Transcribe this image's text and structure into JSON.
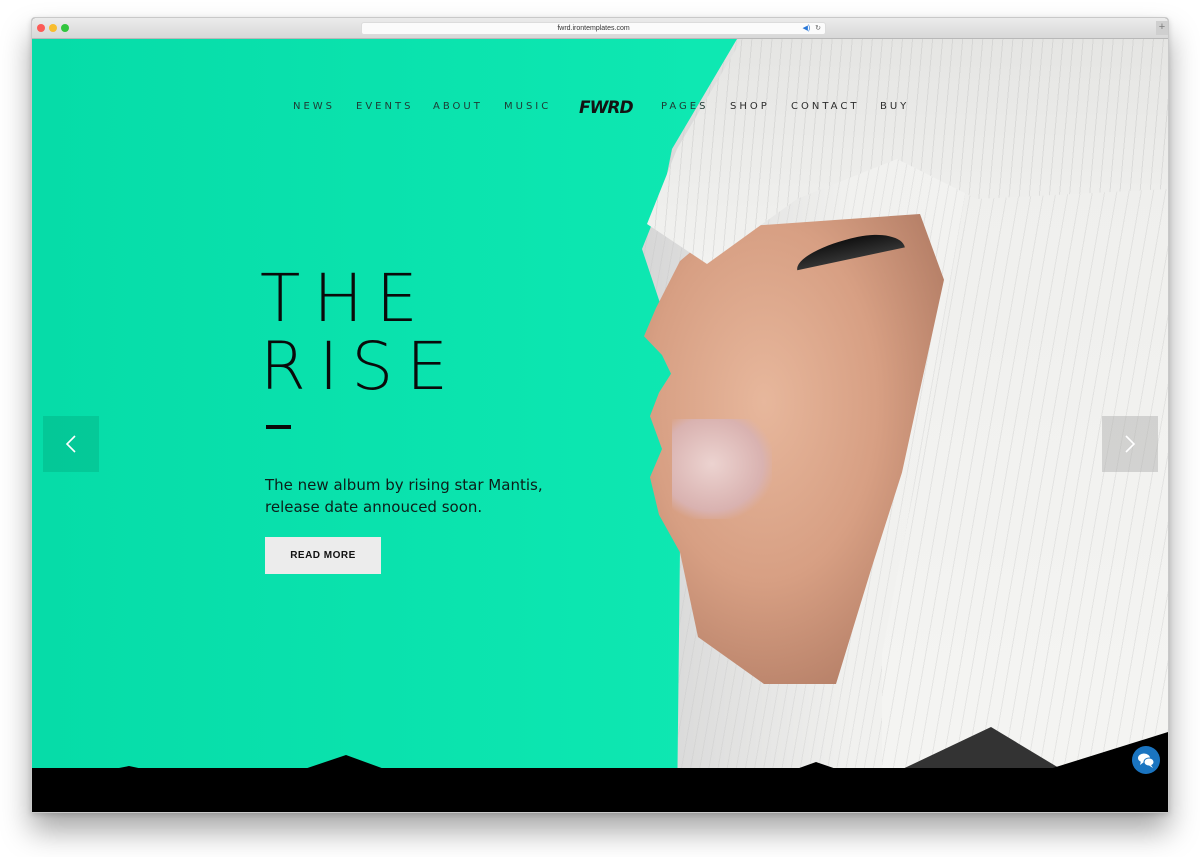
{
  "browser": {
    "url": "fwrd.irontemplates.com",
    "icons": {
      "close": "close-dot",
      "minimize": "minimize-dot",
      "zoom": "zoom-dot",
      "audio": "speaker-icon",
      "reload": "reload-icon",
      "new_tab": "plus-icon"
    },
    "new_tab_glyph": "+",
    "speaker_glyph": "◀)",
    "reload_glyph": "↻"
  },
  "nav": {
    "left": [
      {
        "label": "NEWS"
      },
      {
        "label": "EVENTS"
      },
      {
        "label": "ABOUT"
      },
      {
        "label": "MUSIC"
      }
    ],
    "logo": "FWRD",
    "right": [
      {
        "label": "PAGES"
      },
      {
        "label": "SHOP"
      },
      {
        "label": "CONTACT"
      },
      {
        "label": "BUY"
      }
    ]
  },
  "hero": {
    "title_line1": "THE",
    "title_line2": "RISE",
    "subtitle_line1": "The new album by rising star Mantis,",
    "subtitle_line2": "release date annouced soon.",
    "cta": "READ MORE",
    "prev_icon": "chevron-left-icon",
    "next_icon": "chevron-right-icon"
  },
  "chat_widget": {
    "icon": "chat-bubbles-icon"
  },
  "colors": {
    "accent_teal": "#0de9b0",
    "text_dark": "#0a0a0a",
    "button_bg": "#ececec",
    "chat_blue": "#1a74c0",
    "mountain_dark": "#333333",
    "mountain_black": "#000000"
  }
}
